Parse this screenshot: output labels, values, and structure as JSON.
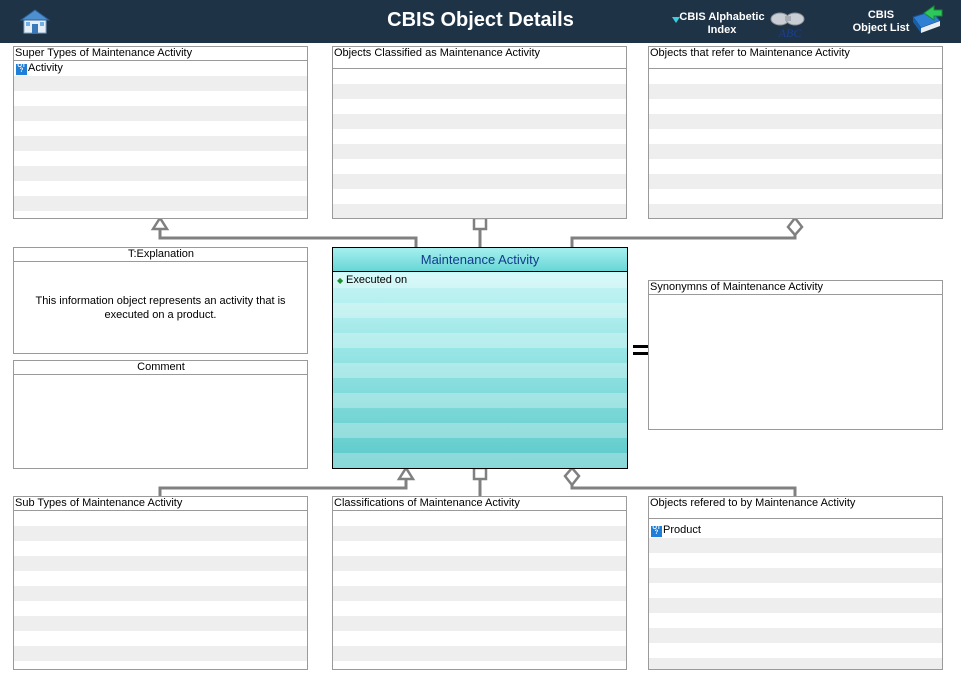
{
  "header": {
    "title": "CBIS Object Details",
    "alpha_index": {
      "line1": "CBIS Alphabetic",
      "line2": "Index",
      "icon": "binoculars-icon"
    },
    "object_list": {
      "line1": "CBIS",
      "line2": "Object List",
      "icon": "book-arrow-icon"
    },
    "home_icon": "house-icon",
    "background": "#1e3346"
  },
  "panels": {
    "super_types": {
      "title": "Super Types of Maintenance Activity",
      "items": [
        "Activity"
      ]
    },
    "classified_as": {
      "title": "Objects Classified as  Maintenance Activity",
      "items": []
    },
    "refer_to": {
      "title": "Objects that refer to   Maintenance Activity",
      "items": []
    },
    "explanation": {
      "title": "T:Explanation",
      "text": "This information object represents an activity that is executed on a product."
    },
    "comment": {
      "title": "Comment",
      "text": ""
    },
    "synonyms": {
      "title": "Synonymns  of Maintenance Activity",
      "items": []
    },
    "sub_types": {
      "title": "Sub Types of Maintenance Activity",
      "items": []
    },
    "classifications": {
      "title": "Classifications of Maintenance Activity",
      "items": []
    },
    "refered_by": {
      "title": "Objects refered to by   Maintenance Activity",
      "items": [
        "Product"
      ]
    }
  },
  "center": {
    "title": "Maintenance Activity",
    "attributes": [
      "Executed on"
    ],
    "title_color": "#123b8a"
  },
  "badge_text": "OT ?",
  "colors": {
    "connector": "#808080",
    "panel_border": "#9a9a9a",
    "stripe": "#eeeeee"
  }
}
